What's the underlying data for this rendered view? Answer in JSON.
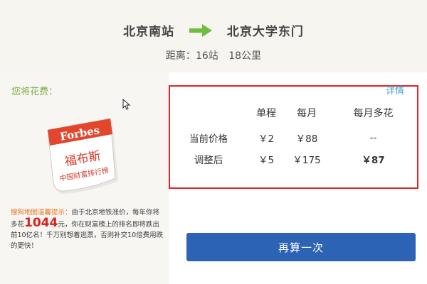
{
  "route": {
    "from": "北京南站",
    "to": "北京大学东门",
    "distance_label": "距离：",
    "stations": "16站",
    "kilometers": "18公里"
  },
  "spend": {
    "label": "您将花费："
  },
  "forbes_card": {
    "brand": "Forbes",
    "title": "福布斯",
    "subtitle": "中国财富排行榜"
  },
  "promo": {
    "prefix": "搜狗地图温馨提示：",
    "text1": "由于北京地铁涨价，每年你将多花",
    "amount": "1044",
    "text2": "元，你在财富榜上的排名即将跌出前10亿名！千万别想着逃票，否则补交10倍费用跌的更快！"
  },
  "compare": {
    "detail_link": "详情",
    "columns": [
      "",
      "单程",
      "每月",
      "每月多花"
    ],
    "rows": [
      [
        "当前价格",
        "￥2",
        "￥88",
        "--"
      ],
      [
        "调整后",
        "￥5",
        "￥175",
        "￥87"
      ]
    ]
  },
  "actions": {
    "recalc_label": "再算一次"
  },
  "colors": {
    "accent_green": "#7aab3e",
    "highlight_red": "#e0252a",
    "button_blue": "#2c63b4",
    "link_blue": "#3aa3d6"
  }
}
